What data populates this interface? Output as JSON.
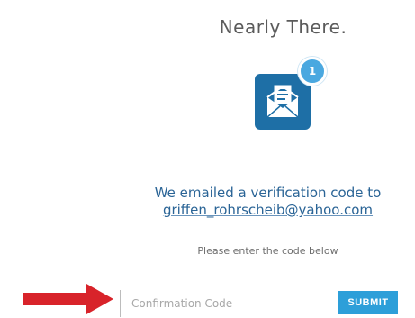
{
  "header": {
    "title": "Nearly There."
  },
  "icon": {
    "name": "envelope-letter-icon",
    "badge_count": "1",
    "tile_color": "#1e6fa6",
    "badge_color": "#4aa8e0"
  },
  "message": {
    "line1": "We emailed a verification code to",
    "email": "griffen_rohrscheib@yahoo.com"
  },
  "hint": "Please enter the code below",
  "form": {
    "code_placeholder": "Confirmation Code",
    "code_value": "",
    "submit_label": "SUBMIT",
    "submit_color": "#2d9fd9"
  },
  "annotation": {
    "arrow_color": "#d8232a",
    "arrow_name": "red-arrow"
  }
}
